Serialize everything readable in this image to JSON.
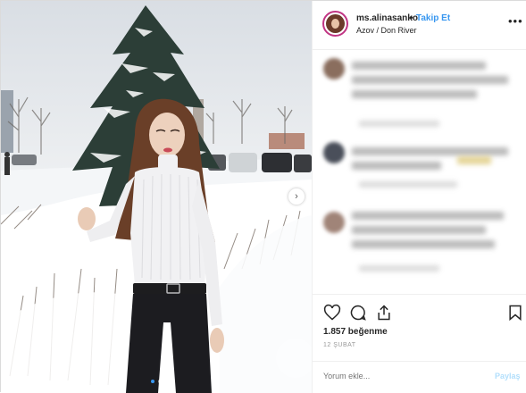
{
  "post": {
    "username": "ms.alinasanko",
    "separator": "•",
    "follow_label": "Takip Et",
    "location": "Azov / Don River",
    "more_icon": "more-horizontal-icon",
    "likes": "1.857 beğenme",
    "date": "12 ŞUBAT",
    "comment_placeholder": "Yorum ekle...",
    "post_label": "Paylaş",
    "next_glyph": "›",
    "carousel": {
      "count": 2,
      "active": 1
    }
  },
  "icons": [
    "heart-icon",
    "comment-icon",
    "share-icon",
    "bookmark-icon"
  ],
  "colors": {
    "accent": "#3897f0",
    "text": "#262626",
    "muted": "#999999",
    "post_disabled": "#b2dffc",
    "avatar_ring": "#c13584"
  }
}
